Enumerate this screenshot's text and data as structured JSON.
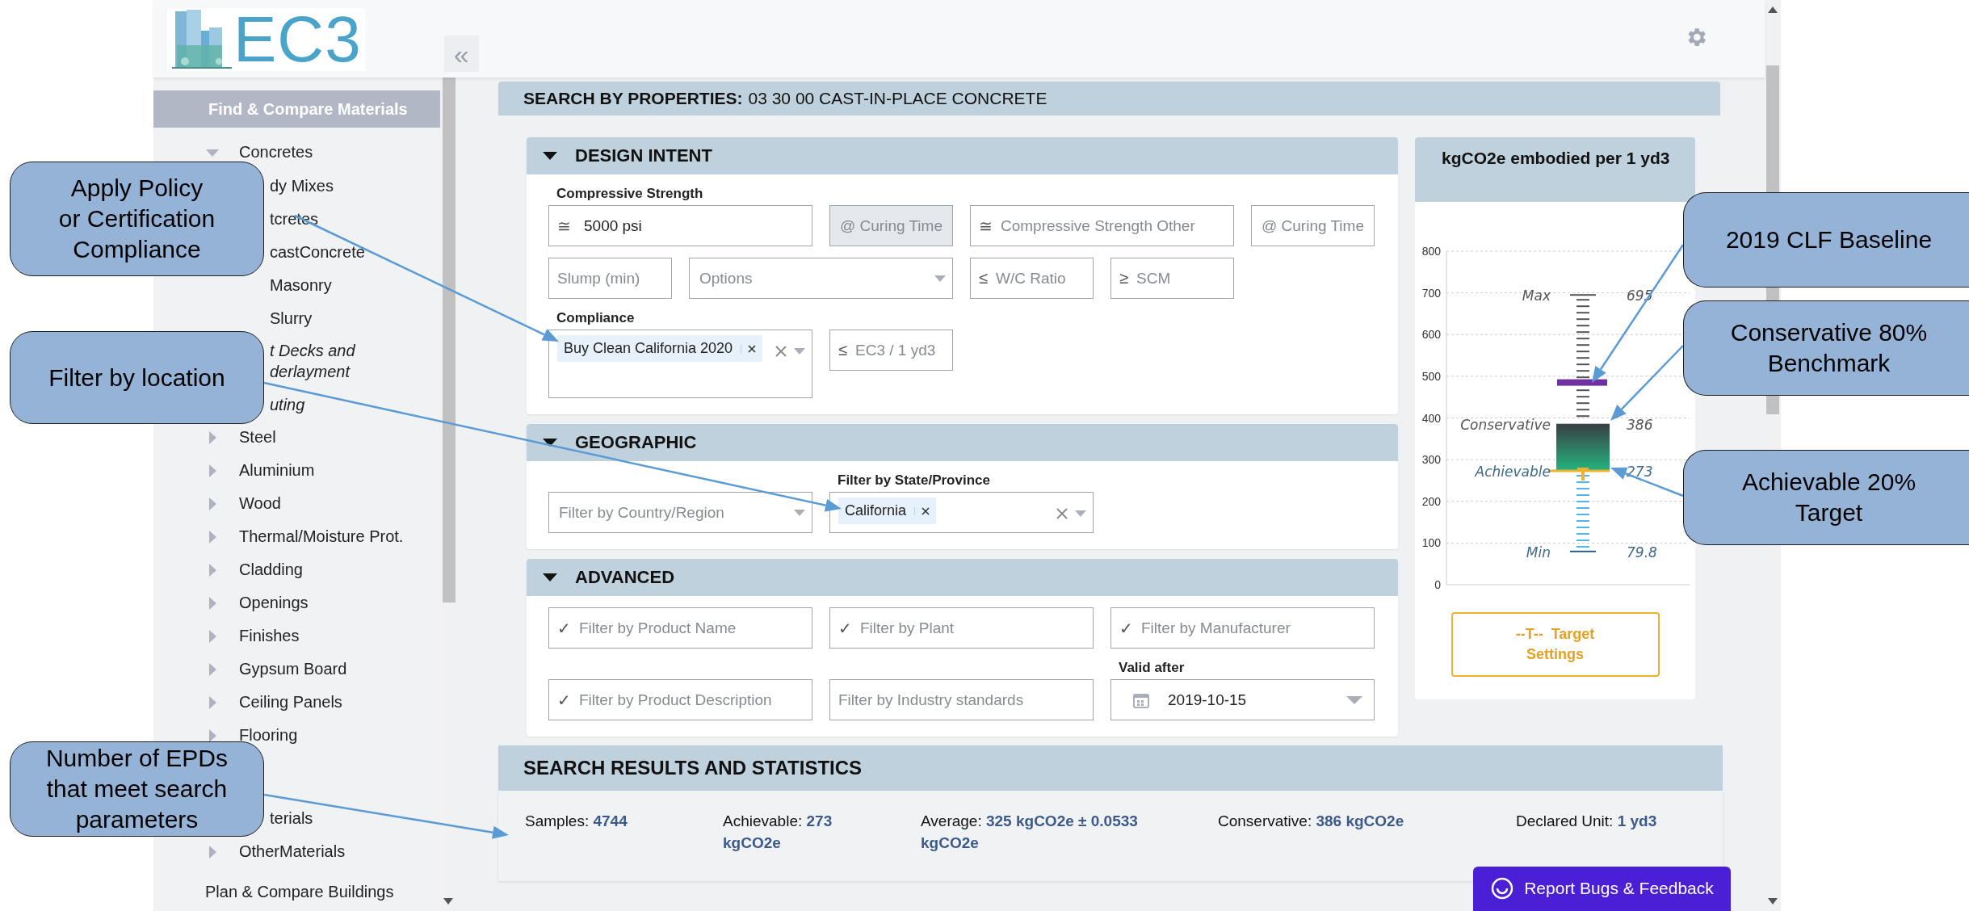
{
  "header": {
    "logo_text": "EC3",
    "collapse_glyph": "«"
  },
  "sidebar": {
    "sections": [
      {
        "label": "Find & Compare Materials",
        "selected": true,
        "tree": [
          {
            "label": "Concretes",
            "expanded": true,
            "children": [
              {
                "label": "dy Mixes",
                "kind": "plain"
              },
              {
                "label": "tcretes",
                "kind": "plain"
              },
              {
                "label": "castConcrete",
                "kind": "plain"
              },
              {
                "label": "Masonry",
                "kind": "plain"
              },
              {
                "label": "Slurry",
                "kind": "plain"
              },
              {
                "label": "t Decks and\nderlayment",
                "kind": "italic"
              },
              {
                "label": "uting",
                "kind": "italic"
              }
            ]
          },
          {
            "label": "Steel",
            "expanded": false
          },
          {
            "label": "Aluminium",
            "expanded": false
          },
          {
            "label": "Wood",
            "expanded": false
          },
          {
            "label": "Thermal/Moisture Prot.",
            "expanded": false
          },
          {
            "label": "Cladding",
            "expanded": false
          },
          {
            "label": "Openings",
            "expanded": false
          },
          {
            "label": "Finishes",
            "expanded": false
          },
          {
            "label": "Gypsum Board",
            "expanded": false
          },
          {
            "label": "Ceiling Panels",
            "expanded": false
          },
          {
            "label": "Flooring",
            "expanded": false
          },
          {
            "label": "terials"
          },
          {
            "label": "OtherMaterials",
            "expanded": false
          }
        ]
      },
      {
        "label": "Plan & Compare Buildings",
        "selected": false
      }
    ]
  },
  "search_panel": {
    "title": "**SEARCH BY PROPERTIES:** 03 30 00 CAST-IN-PLACE CONCRETE",
    "sections": [
      {
        "title": "DESIGN INTENT",
        "expanded": true,
        "rows": [
          {
            "fields": [
              {
                "kind": "text",
                "label": "Compressive Strength",
                "prefix": "≅",
                "value": "5000 psi",
                "disabled": false
              },
              {
                "kind": "select",
                "placeholder": "@ Curing Time",
                "disabled": true
              },
              {
                "kind": "text",
                "prefix": "≅",
                "placeholder": "Compressive Strength Other",
                "disabled": false
              },
              {
                "kind": "select",
                "placeholder": "@ Curing Time",
                "disabled": false
              }
            ]
          },
          {
            "fields": [
              {
                "kind": "text",
                "placeholder": "Slump (min)",
                "disabled": false
              },
              {
                "kind": "select",
                "placeholder": "Options",
                "disabled": false
              },
              {
                "kind": "text",
                "prefix": "≤",
                "placeholder": "W/C Ratio",
                "disabled": false
              },
              {
                "kind": "text",
                "prefix": "≥",
                "placeholder": "SCM",
                "disabled": false
              }
            ]
          },
          {
            "fields": [
              {
                "kind": "tags",
                "label": "Compliance",
                "tags": [
                  "Buy Clean California 2020"
                ],
                "disabled": false
              },
              {
                "kind": "text",
                "prefix": "≤",
                "placeholder": "EC3 / 1 yd3",
                "disabled": false
              }
            ]
          }
        ]
      },
      {
        "title": "GEOGRAPHIC",
        "expanded": true,
        "rows": [
          {
            "fields": [
              {
                "kind": "select",
                "placeholder": "Filter by Country/Region",
                "disabled": false
              },
              {
                "kind": "tags",
                "label": "Filter by State/Province",
                "tags": [
                  "California"
                ],
                "disabled": false
              }
            ]
          }
        ]
      },
      {
        "title": "ADVANCED",
        "expanded": true,
        "rows": [
          {
            "fields": [
              {
                "kind": "text",
                "prefix": "✓",
                "placeholder": "Filter by Product Name",
                "disabled": false
              },
              {
                "kind": "text",
                "prefix": "✓",
                "placeholder": "Filter by Plant",
                "disabled": false
              },
              {
                "kind": "text",
                "prefix": "✓",
                "placeholder": "Filter by Manufacturer",
                "disabled": false
              }
            ]
          },
          {
            "fields": [
              {
                "kind": "text",
                "prefix": "✓",
                "placeholder": "Filter by Product Description",
                "disabled": false
              },
              {
                "kind": "text",
                "placeholder": "Filter by Industry standards",
                "disabled": false
              },
              {
                "kind": "date",
                "label": "Valid after",
                "value": "2019-10-15",
                "disabled": false
              }
            ]
          }
        ]
      }
    ],
    "chart_card": {
      "title": "kgCO2e embodied per 1 yd3",
      "axis_labels": [
        "800",
        "700",
        "600",
        "500",
        "400",
        "300",
        "200",
        "100",
        "0"
      ],
      "markers": [
        {
          "label": "Max",
          "value": "695"
        },
        {
          "label": "Conservative",
          "value": "386"
        },
        {
          "label": "Achievable",
          "value": "273"
        },
        {
          "label": "Min",
          "value": "79.8"
        }
      ],
      "target_button": "--T--  Target Settings"
    }
  },
  "results": {
    "title": "SEARCH RESULTS AND STATISTICS",
    "stats": [
      {
        "label": "Samples:",
        "value": "4744"
      },
      {
        "label": "Achievable:",
        "value": "273 kgCO2e"
      },
      {
        "label": "Average:",
        "value": "325 kgCO2e ± 0.0533 kgCO2e"
      },
      {
        "label": "Conservative:",
        "value": "386 kgCO2e"
      },
      {
        "label": "Declared Unit:",
        "value": "1 yd3"
      }
    ]
  },
  "report_button": "Report Bugs & Feedback",
  "callouts": [
    {
      "text": "Apply Policy\nor Certification\nCompliance"
    },
    {
      "text": "Filter by location"
    },
    {
      "text": "Number of EPDs\nthat meet search\nparameters"
    },
    {
      "text": "2019 CLF Baseline"
    },
    {
      "text": "Conservative 80%\nBenchmark"
    },
    {
      "text": "Achievable 20%\nTarget"
    }
  ]
}
